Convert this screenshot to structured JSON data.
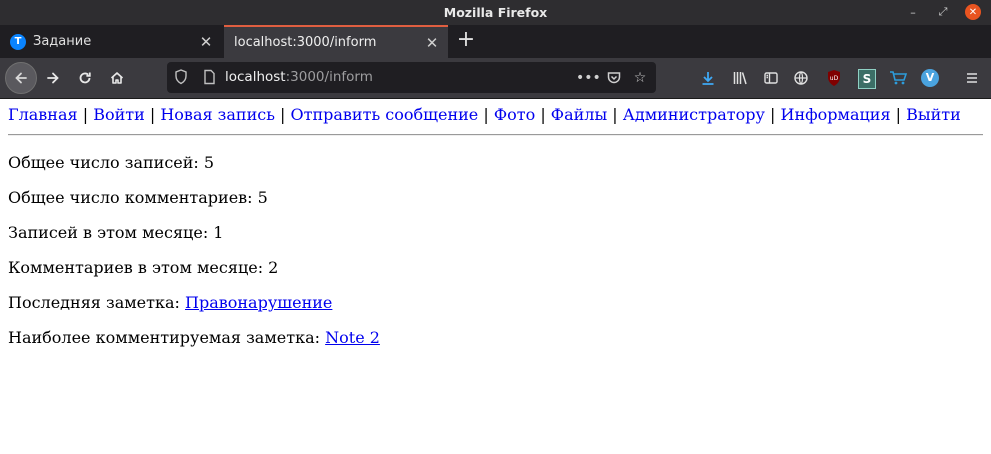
{
  "window": {
    "title": "Mozilla Firefox",
    "controls": {
      "minimize": "–",
      "maximize": "⤢",
      "close": "✕"
    }
  },
  "tabs": [
    {
      "label": "Задание",
      "favicon": "T",
      "active": false,
      "close": "✕"
    },
    {
      "label": "localhost:3000/inform",
      "active": true,
      "close": "✕"
    }
  ],
  "newtab_label": "+",
  "toolbar": {
    "url_host": "localhost",
    "url_path": ":3000/inform",
    "icons": [
      "back-icon",
      "forward-icon",
      "reload-icon",
      "home-icon",
      "shield-icon",
      "page-info-icon",
      "more-icon",
      "pocket-icon",
      "bookmark-star-icon",
      "download-icon",
      "library-icon",
      "sidebar-icon",
      "globe-icon",
      "ublock-icon",
      "extension-s-icon",
      "cart-icon",
      "extension-v-icon",
      "menu-icon"
    ]
  },
  "nav": {
    "items": [
      {
        "label": "Главная"
      },
      {
        "label": "Войти"
      },
      {
        "label": "Новая запись"
      },
      {
        "label": "Отправить сообщение"
      },
      {
        "label": "Фото"
      },
      {
        "label": "Файлы"
      },
      {
        "label": "Администратору"
      },
      {
        "label": "Информация"
      },
      {
        "label": "Выйти"
      }
    ],
    "separator": "|"
  },
  "stats": {
    "total_entries": "Общее число записей: 5",
    "total_comments": "Общее число комментариев: 5",
    "month_entries": "Записей в этом месяце: 1",
    "month_comments": "Комментариев в этом месяце: 2",
    "last_note_label": "Последняя заметка: ",
    "last_note_link": "Правонарушение",
    "most_commented_label": "Наиболее комментируемая заметка: ",
    "most_commented_link": "Note 2"
  },
  "colors": {
    "link": "#0000ee",
    "titlebar": "#2e2d30",
    "toolbar": "#3b3a3f",
    "tab_accent": "#e05e40"
  }
}
